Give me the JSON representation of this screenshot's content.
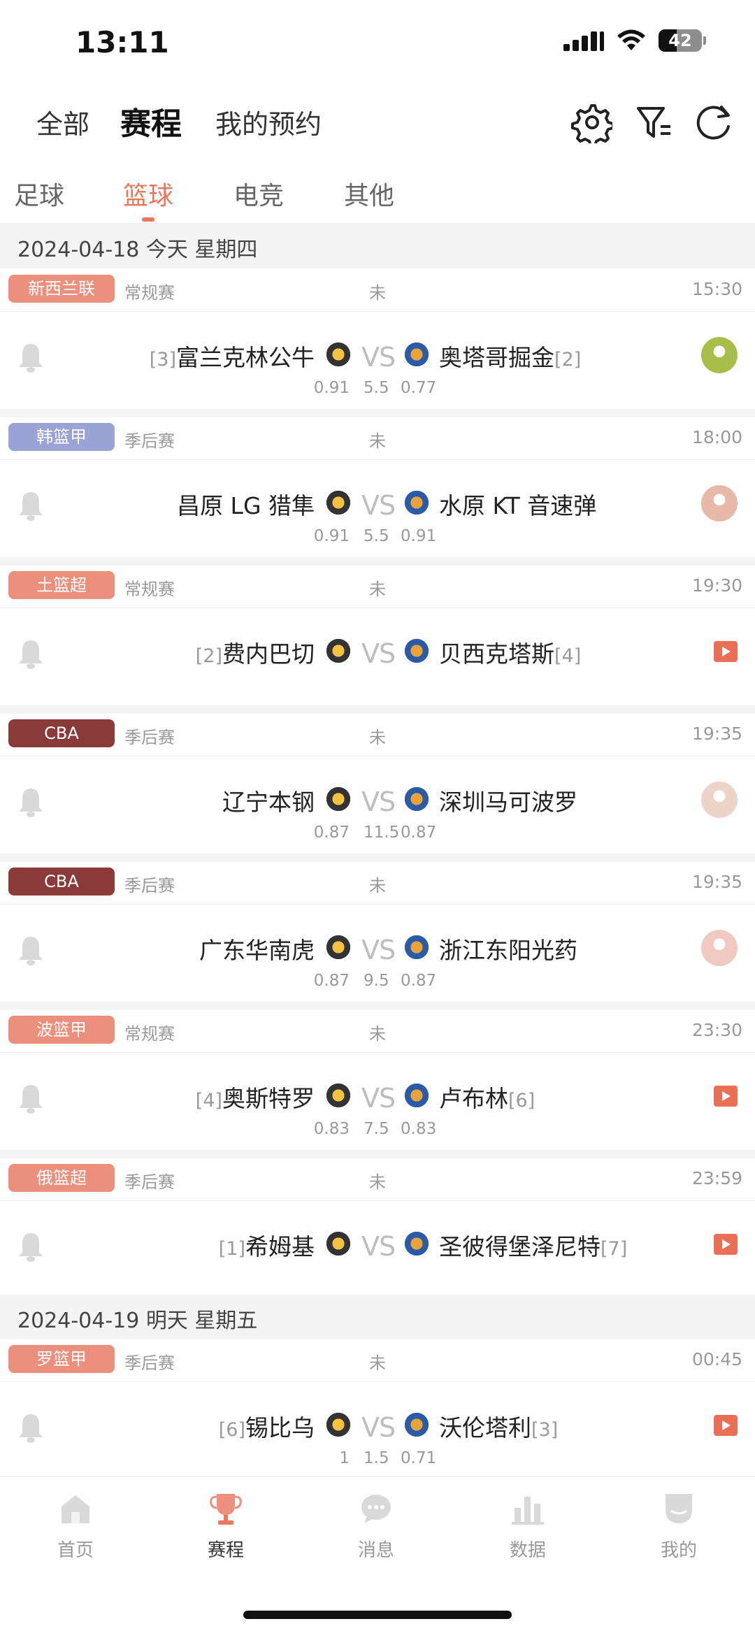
{
  "status_bar": {
    "time": "13:11",
    "battery": "42"
  },
  "header": {
    "tabs": [
      "全部",
      "赛程",
      "我的预约"
    ],
    "active_tab": "赛程"
  },
  "sport_tabs": [
    "足球",
    "篮球",
    "电竞",
    "其他"
  ],
  "sections": [
    {
      "date": "2024-04-18 今天 星期四",
      "matches": [
        {
          "league": "新西兰联",
          "league_color": "#ec8f7c",
          "round": "常规赛",
          "status": "未",
          "time": "15:30",
          "home": "富兰克林公牛",
          "home_rank": "[3]",
          "away": "奥塔哥掘金",
          "away_rank": "[2]",
          "vs": "VS",
          "odds": [
            "0.91",
            "5.5",
            "0.77"
          ],
          "right": "avatar"
        },
        {
          "league": "韩篮甲",
          "league_color": "#9ba2d6",
          "round": "季后赛",
          "status": "未",
          "time": "18:00",
          "home": "昌原 LG 猎隼",
          "home_rank": "",
          "away": "水原 KT 音速弹",
          "away_rank": "",
          "vs": "VS",
          "odds": [
            "0.91",
            "5.5",
            "0.91"
          ],
          "right": "avatar"
        },
        {
          "league": "土篮超",
          "league_color": "#ec8f7c",
          "round": "常规赛",
          "status": "未",
          "time": "19:30",
          "home": "费内巴切",
          "home_rank": "[2]",
          "away": "贝西克塔斯",
          "away_rank": "[4]",
          "vs": "VS",
          "odds": [
            "",
            "",
            ""
          ],
          "right": "play"
        },
        {
          "league": "CBA",
          "league_color": "#8b3a3a",
          "round": "季后赛",
          "status": "未",
          "time": "19:35",
          "home": "辽宁本钢",
          "home_rank": "",
          "away": "深圳马可波罗",
          "away_rank": "",
          "vs": "VS",
          "odds": [
            "0.87",
            "11.5",
            "0.87"
          ],
          "right": "avatar"
        },
        {
          "league": "CBA",
          "league_color": "#8b3a3a",
          "round": "季后赛",
          "status": "未",
          "time": "19:35",
          "home": "广东华南虎",
          "home_rank": "",
          "away": "浙江东阳光药",
          "away_rank": "",
          "vs": "VS",
          "odds": [
            "0.87",
            "9.5",
            "0.87"
          ],
          "right": "avatar"
        },
        {
          "league": "波篮甲",
          "league_color": "#ec8f7c",
          "round": "常规赛",
          "status": "未",
          "time": "23:30",
          "home": "奥斯特罗",
          "home_rank": "[4]",
          "away": "卢布林",
          "away_rank": "[6]",
          "vs": "VS",
          "odds": [
            "0.83",
            "7.5",
            "0.83"
          ],
          "right": "play"
        },
        {
          "league": "俄篮超",
          "league_color": "#ec8f7c",
          "round": "季后赛",
          "status": "未",
          "time": "23:59",
          "home": "希姆基",
          "home_rank": "[1]",
          "away": "圣彼得堡泽尼特",
          "away_rank": "[7]",
          "vs": "VS",
          "odds": [
            "",
            "",
            ""
          ],
          "right": "play"
        }
      ]
    },
    {
      "date": "2024-04-19 明天 星期五",
      "matches": [
        {
          "league": "罗篮甲",
          "league_color": "#ec8f7c",
          "round": "季后赛",
          "status": "未",
          "time": "00:45",
          "home": "锡比乌",
          "home_rank": "[6]",
          "away": "沃伦塔利",
          "away_rank": "[3]",
          "vs": "VS",
          "odds": [
            "1",
            "1.5",
            "0.71"
          ],
          "right": "play"
        }
      ]
    }
  ],
  "bottom_nav": [
    {
      "label": "首页",
      "icon": "home-icon"
    },
    {
      "label": "赛程",
      "icon": "trophy-icon"
    },
    {
      "label": "消息",
      "icon": "message-icon"
    },
    {
      "label": "数据",
      "icon": "chart-icon"
    },
    {
      "label": "我的",
      "icon": "profile-icon"
    }
  ],
  "colors": {
    "accent": "#e8775c",
    "cba": "#8b3a3a",
    "kbl": "#9ba2d6",
    "tag": "#ec8f7c"
  }
}
